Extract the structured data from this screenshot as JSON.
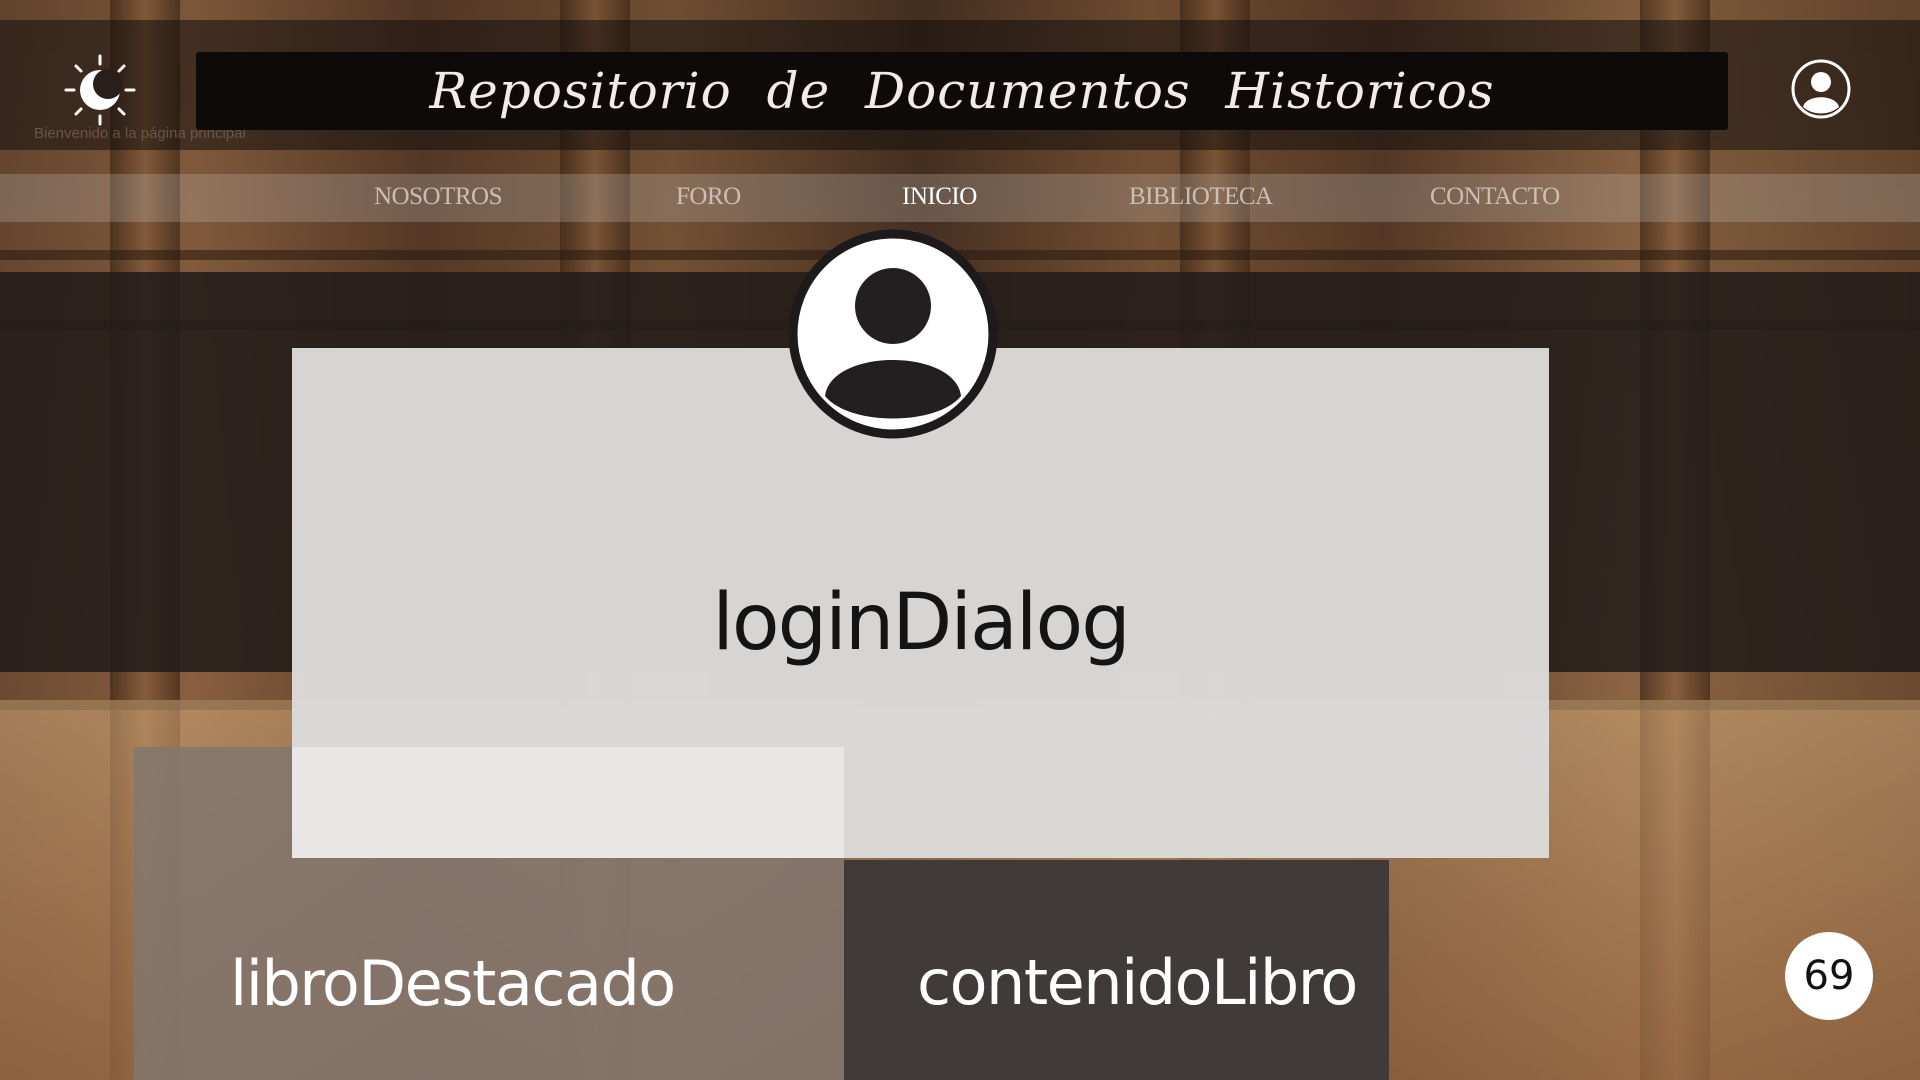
{
  "header": {
    "title": "Repositorio de Documentos Historicos",
    "welcome_text": "Bienvenido a la página principal",
    "theme_icon": "sun-moon-icon",
    "user_icon": "user-circle-icon"
  },
  "nav": {
    "items": [
      {
        "label": "NOSOTROS",
        "active": false
      },
      {
        "label": "FORO",
        "active": false
      },
      {
        "label": "INICIO",
        "active": true
      },
      {
        "label": "BIBLIOTECA",
        "active": false
      },
      {
        "label": "CONTACTO",
        "active": false
      }
    ]
  },
  "dialog": {
    "label": "loginDialog",
    "avatar_icon": "user-avatar-icon"
  },
  "panels": {
    "featured_label": "libroDestacado",
    "content_label": "contenidoLibro"
  },
  "page_badge": "69",
  "colors": {
    "title_bar": "#0e0a09",
    "dialog_bg": "#dcdbda",
    "content_panel": "#403a38",
    "active_nav": "#ffffff"
  }
}
